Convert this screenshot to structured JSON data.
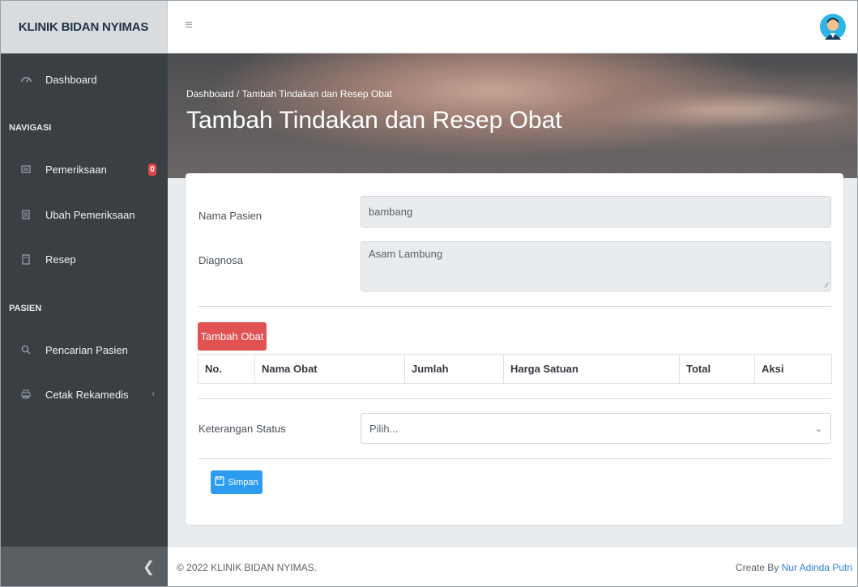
{
  "brand": "KLINIK BIDAN NYIMAS",
  "sidebar": {
    "dashboard": "Dashboard",
    "section_navigasi": "NAVIGASI",
    "pemeriksaan": "Pemeriksaan",
    "pemeriksaan_badge": "0",
    "ubah_pemeriksaan": "Ubah Pemeriksaan",
    "resep": "Resep",
    "section_pasien": "PASIEN",
    "pencarian_pasien": "Pencarian Pasien",
    "cetak_rekamedis": "Cetak Rekamedis"
  },
  "header": {
    "breadcrumb": "Dashboard / Tambah Tindakan dan Resep Obat",
    "title": "Tambah Tindakan dan Resep Obat"
  },
  "form": {
    "nama_pasien_label": "Nama Pasien",
    "nama_pasien_value": "bambang",
    "diagnosa_label": "Diagnosa",
    "diagnosa_value": "Asam Lambung",
    "tambah_obat_label": "Tambah Obat",
    "table_headers": [
      "No.",
      "Nama Obat",
      "Jumlah",
      "Harga Satuan",
      "Total",
      "Aksi"
    ],
    "status_label": "Keterangan Status",
    "status_selected": "Pilih...",
    "simpan_label": "Simpan"
  },
  "footer": {
    "copyright": "© 2022 KLINIK BIDAN NYIMAS.",
    "credit_prefix": "Create By",
    "credit_name": "Nur Adinda Putri"
  },
  "colors": {
    "sidebar": "#3a3f44",
    "danger": "#e25252",
    "primary": "#2d9cf0",
    "link": "#2d7fd6"
  },
  "icons": [
    "dashboard-icon",
    "pemeriksaan-icon",
    "ubah-pemeriksaan-icon",
    "resep-icon",
    "search-icon",
    "print-icon",
    "chevron-left-icon",
    "hamburger-icon",
    "avatar",
    "save-icon",
    "chevron-down-icon"
  ]
}
